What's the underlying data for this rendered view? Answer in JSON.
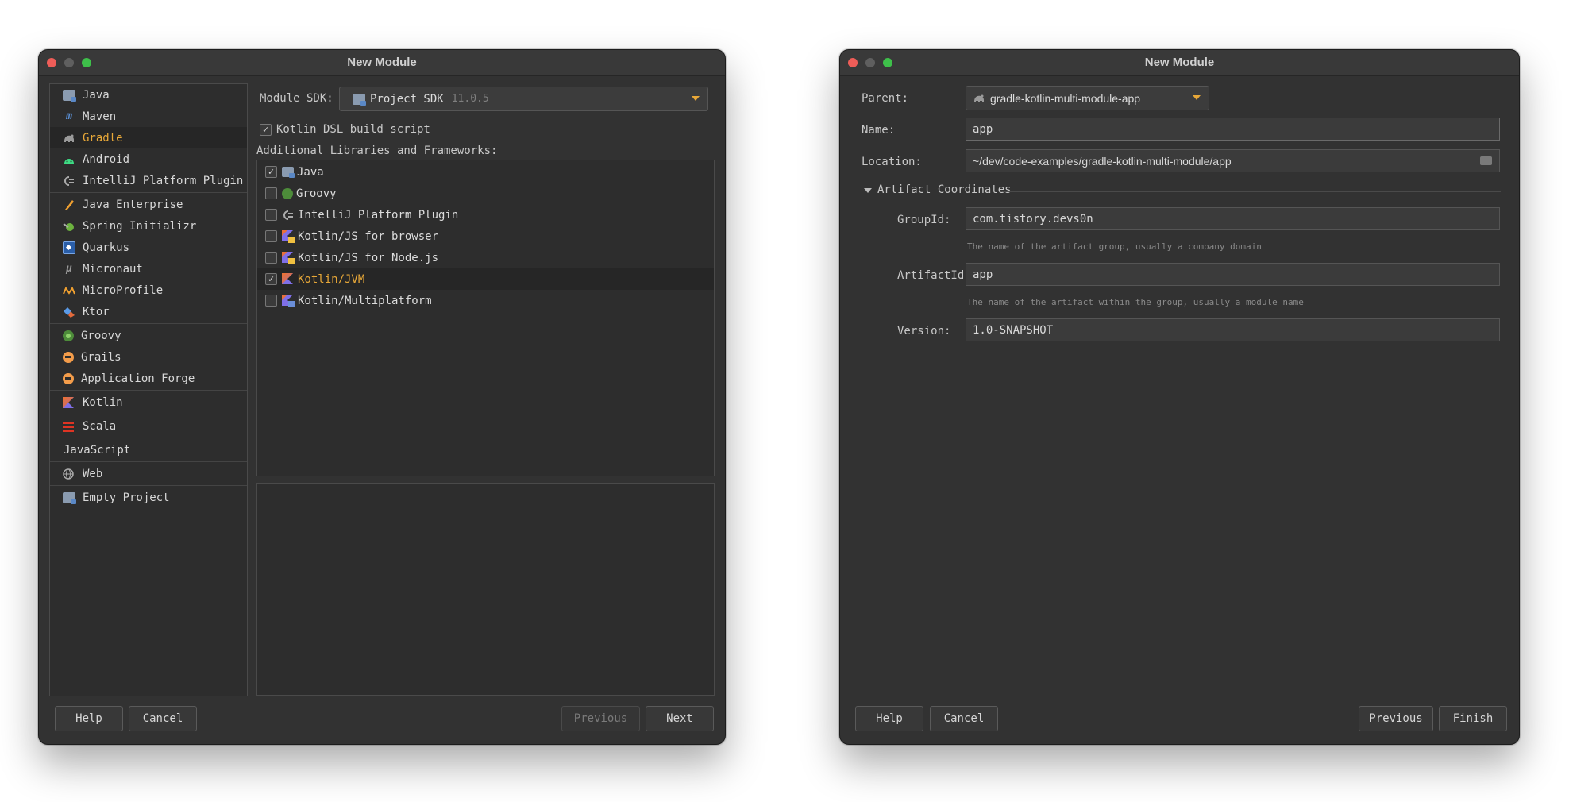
{
  "window1": {
    "title": "New Module",
    "types": [
      {
        "label": "Java",
        "icon": "java-folder-icon"
      },
      {
        "label": "Maven",
        "icon": "maven-icon"
      },
      {
        "label": "Gradle",
        "icon": "gradle-elephant-icon",
        "selected": true
      },
      {
        "label": "Android",
        "icon": "android-icon"
      },
      {
        "label": "IntelliJ Platform Plugin",
        "icon": "plugin-icon"
      },
      {
        "label": "Java Enterprise",
        "icon": "java-enterprise-icon"
      },
      {
        "label": "Spring Initializr",
        "icon": "spring-icon"
      },
      {
        "label": "Quarkus",
        "icon": "quarkus-icon"
      },
      {
        "label": "Micronaut",
        "icon": "micronaut-icon"
      },
      {
        "label": "MicroProfile",
        "icon": "microprofile-icon"
      },
      {
        "label": "Ktor",
        "icon": "ktor-icon"
      },
      {
        "label": "Groovy",
        "icon": "groovy-icon"
      },
      {
        "label": "Grails",
        "icon": "grails-icon"
      },
      {
        "label": "Application Forge",
        "icon": "application-forge-icon"
      },
      {
        "label": "Kotlin",
        "icon": "kotlin-icon"
      },
      {
        "label": "Scala",
        "icon": "scala-icon"
      },
      {
        "label": "JavaScript",
        "icon": ""
      },
      {
        "label": "Web",
        "icon": "web-globe-icon"
      },
      {
        "label": "Empty Project",
        "icon": "empty-project-folder-icon"
      }
    ],
    "module_sdk_label": "Module SDK:",
    "sdk_name": "Project SDK",
    "sdk_version": "11.0.5",
    "kotlin_dsl_label": "Kotlin DSL build script",
    "kotlin_dsl_checked": true,
    "frameworks_label": "Additional Libraries and Frameworks:",
    "frameworks": [
      {
        "label": "Java",
        "checked": true
      },
      {
        "label": "Groovy",
        "checked": false
      },
      {
        "label": "IntelliJ Platform Plugin",
        "checked": false
      },
      {
        "label": "Kotlin/JS for browser",
        "checked": false
      },
      {
        "label": "Kotlin/JS for Node.js",
        "checked": false
      },
      {
        "label": "Kotlin/JVM",
        "checked": true,
        "selected": true
      },
      {
        "label": "Kotlin/Multiplatform",
        "checked": false
      }
    ],
    "buttons": {
      "help": "Help",
      "cancel": "Cancel",
      "previous": "Previous",
      "next": "Next"
    }
  },
  "window2": {
    "title": "New Module",
    "parent_label": "Parent:",
    "parent_value": "gradle-kotlin-multi-module-app",
    "name_label": "Name:",
    "name_value": "app",
    "location_label": "Location:",
    "location_value": "~/dev/code-examples/gradle-kotlin-multi-module/app",
    "artifact_section": "Artifact Coordinates",
    "groupid_label": "GroupId:",
    "groupid_value": "com.tistory.devs0n",
    "groupid_hint": "The name of the artifact group, usually a company domain",
    "artifactid_label": "ArtifactId:",
    "artifactid_value": "app",
    "artifactid_hint": "The name of the artifact within the group, usually a module name",
    "version_label": "Version:",
    "version_value": "1.0-SNAPSHOT",
    "buttons": {
      "help": "Help",
      "cancel": "Cancel",
      "previous": "Previous",
      "finish": "Finish"
    }
  },
  "colors": {
    "accent": "#e8a838",
    "background": "#323232"
  }
}
